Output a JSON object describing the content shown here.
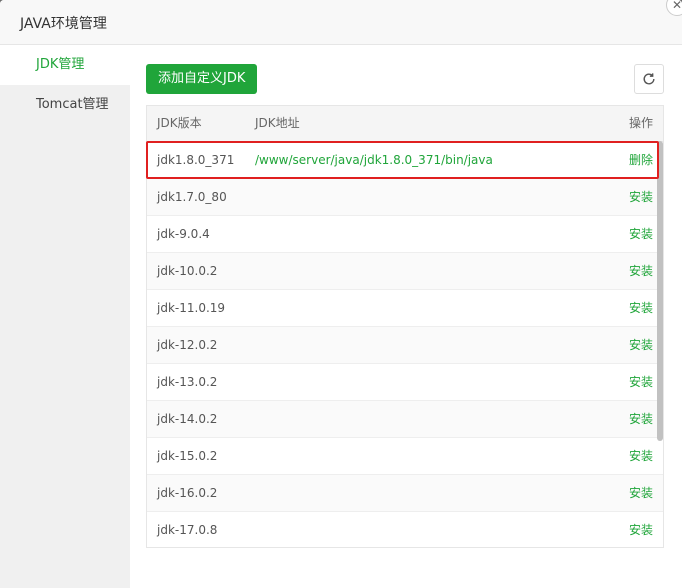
{
  "dialog": {
    "title": "JAVA环境管理",
    "close_icon": "close-icon"
  },
  "sidebar": {
    "items": [
      {
        "label": "JDK管理",
        "active": true
      },
      {
        "label": "Tomcat管理",
        "active": false
      }
    ]
  },
  "toolbar": {
    "add_label": "添加自定义JDK",
    "refresh_icon": "refresh-icon"
  },
  "table": {
    "headers": {
      "version": "JDK版本",
      "path": "JDK地址",
      "action": "操作"
    },
    "rows": [
      {
        "version": "jdk1.8.0_371",
        "path": "/www/server/java/jdk1.8.0_371/bin/java",
        "action": "删除",
        "highlighted": true
      },
      {
        "version": "jdk1.7.0_80",
        "path": "",
        "action": "安装"
      },
      {
        "version": "jdk-9.0.4",
        "path": "",
        "action": "安装"
      },
      {
        "version": "jdk-10.0.2",
        "path": "",
        "action": "安装"
      },
      {
        "version": "jdk-11.0.19",
        "path": "",
        "action": "安装"
      },
      {
        "version": "jdk-12.0.2",
        "path": "",
        "action": "安装"
      },
      {
        "version": "jdk-13.0.2",
        "path": "",
        "action": "安装"
      },
      {
        "version": "jdk-14.0.2",
        "path": "",
        "action": "安装"
      },
      {
        "version": "jdk-15.0.2",
        "path": "",
        "action": "安装"
      },
      {
        "version": "jdk-16.0.2",
        "path": "",
        "action": "安装"
      },
      {
        "version": "jdk-17.0.8",
        "path": "",
        "action": "安装"
      }
    ]
  },
  "colors": {
    "accent": "#20a53a",
    "highlight": "#e02020"
  }
}
